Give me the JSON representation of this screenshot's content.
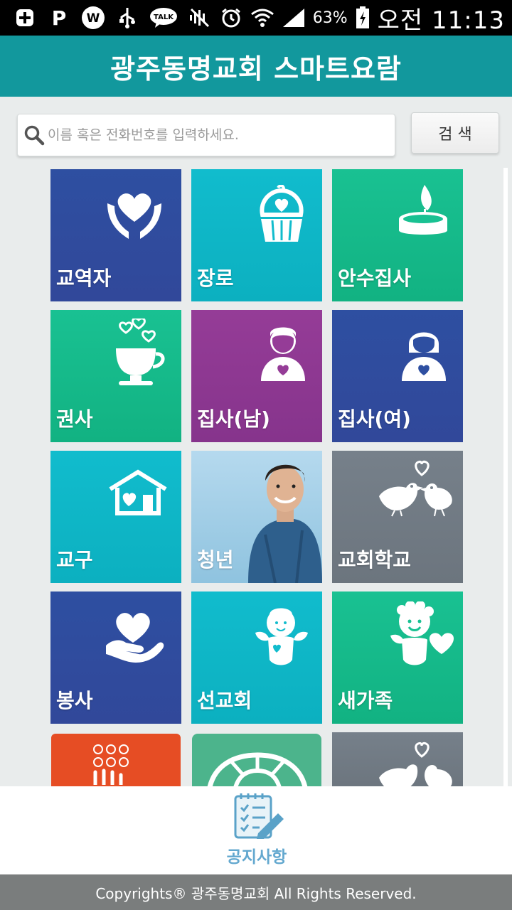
{
  "status_bar": {
    "icons": [
      "plus-icon",
      "parking-icon",
      "w-icon",
      "usb-icon",
      "talk-icon",
      "mute-icon",
      "alarm-icon",
      "wifi-icon",
      "signal-icon",
      "battery-icon"
    ],
    "talk_text": "TALK",
    "w_text": "W",
    "p_text": "P",
    "battery": "63%",
    "time": "오전 11:13"
  },
  "header": {
    "title": "광주동명교회 스마트요람"
  },
  "search": {
    "placeholder": "이름 혹은 전화번호를 입력하세요.",
    "value": "",
    "button_label": "검 색"
  },
  "tiles": [
    {
      "label": "교역자",
      "color": "#2e4fa1",
      "icon": "hands-heart-icon"
    },
    {
      "label": "장로",
      "color": "#11bccd",
      "icon": "cupcake-heart-icon"
    },
    {
      "label": "안수집사",
      "color": "#19c192",
      "icon": "candle-icon"
    },
    {
      "label": "권사",
      "color": "#19c192",
      "icon": "coffee-cup-hearts-icon"
    },
    {
      "label": "집사(남)",
      "color": "#953c97",
      "icon": "man-heart-icon"
    },
    {
      "label": "집사(여)",
      "color": "#2e4fa1",
      "icon": "woman-heart-icon"
    },
    {
      "label": "교구",
      "color": "#11bccd",
      "icon": "house-heart-icon"
    },
    {
      "label": "청년",
      "color": "#8fc3df",
      "icon": "young-man-photo"
    },
    {
      "label": "교회학교",
      "color": "#76808a",
      "icon": "birds-heart-icon"
    },
    {
      "label": "봉사",
      "color": "#2e4fa1",
      "icon": "hand-heart-icon"
    },
    {
      "label": "선교회",
      "color": "#11bccd",
      "icon": "angel-icon"
    },
    {
      "label": "새가족",
      "color": "#19c192",
      "icon": "cherub-heart-icon"
    },
    {
      "label": "",
      "color": "#e64d24",
      "icon": "braille-hand-icon"
    },
    {
      "label": "",
      "color": "#4cb48c",
      "icon": "turtle-shell-icon"
    },
    {
      "label": "",
      "color": "#76808a",
      "icon": "birds-heart-icon"
    }
  ],
  "bottom": {
    "notice_label": "공지사항"
  },
  "footer": {
    "copyright": "Copyrights® 광주동명교회 All Rights Reserved."
  }
}
